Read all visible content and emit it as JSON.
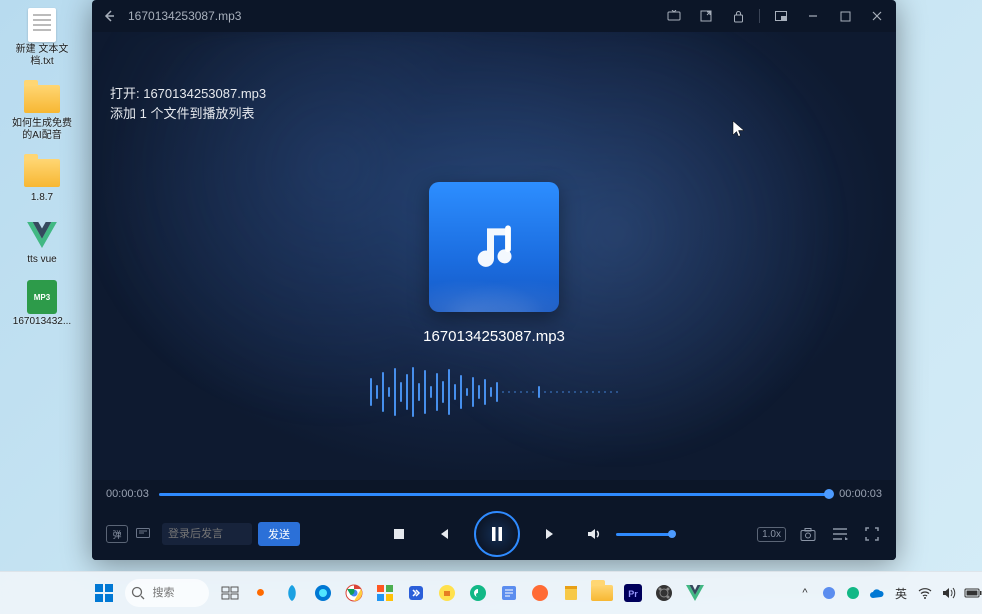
{
  "desktop": {
    "icons": [
      {
        "type": "txt",
        "label": "新建 文本文档.txt"
      },
      {
        "type": "folder",
        "label": "如何生成免费的AI配音"
      },
      {
        "type": "folder",
        "label": "1.8.7"
      },
      {
        "type": "vue",
        "label": "tts vue"
      },
      {
        "type": "mp3",
        "label": "167013432..."
      }
    ]
  },
  "player": {
    "title": "1670134253087.mp3",
    "status_line1": "打开: 1670134253087.mp3",
    "status_line2": "添加 1 个文件到播放列表",
    "track_name": "1670134253087.mp3",
    "elapsed": "00:00:03",
    "duration": "00:00:03",
    "danmu_toggle": "弹",
    "danmu_placeholder": "登录后发言",
    "danmu_send": "发送",
    "speed": "1.0x"
  },
  "taskbar": {
    "search_placeholder": "搜索",
    "ime": "英",
    "chevron": "^"
  }
}
